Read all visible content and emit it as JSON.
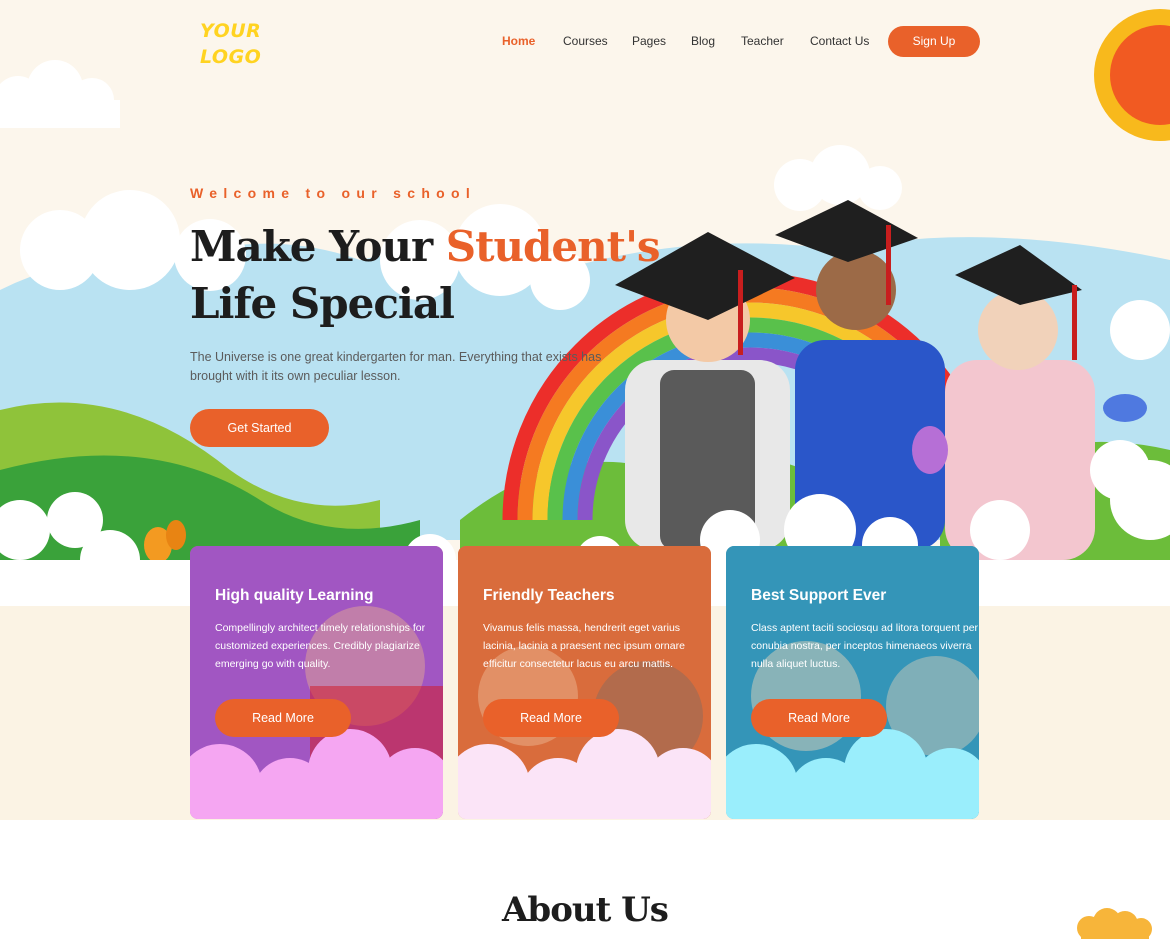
{
  "header": {
    "logo_line1": "YOUR",
    "logo_line2": "LOGO",
    "nav": [
      {
        "label": "Home",
        "active": true
      },
      {
        "label": "Courses",
        "active": false
      },
      {
        "label": "Pages",
        "active": false
      },
      {
        "label": "Blog",
        "active": false
      },
      {
        "label": "Teacher",
        "active": false
      },
      {
        "label": "Contact Us",
        "active": false
      }
    ],
    "signup_label": "Sign Up"
  },
  "hero": {
    "eyebrow": "Welcome to our school",
    "headline_part1": "Make Your ",
    "headline_accent": "Student's",
    "headline_line2": "Life Special",
    "lead": "The Universe is one great kindergarten for man. Everything that exists has brought with it its own peculiar lesson.",
    "cta_label": "Get Started",
    "illustration_icons": [
      "sun-icon",
      "rainbow-icon",
      "graduation-cap-icon",
      "butterfly-icon"
    ]
  },
  "features": [
    {
      "title": "High quality Learning",
      "text": "Compellingly architect timely relationships for customized experiences. Credibly plagiarize emerging go with quality.",
      "button": "Read More",
      "color": "#8d4fe4"
    },
    {
      "title": "Friendly Teachers",
      "text": "Vivamus felis massa, hendrerit eget varius lacinia, lacinia a praesent nec ipsum ornare efficitur consectetur lacus eu arcu mattis.",
      "button": "Read More",
      "color": "#e9612a"
    },
    {
      "title": "Best Support Ever",
      "text": "Class aptent taciti sociosqu ad litora torquent per conubia nostra, per inceptos himenaeos viverra nulla aliquet luctus.",
      "button": "Read More",
      "color": "#0d8fc0"
    }
  ],
  "about": {
    "title": "About Us"
  },
  "colors": {
    "accent": "#e9612a",
    "logo": "#ffd321",
    "hero_bg": "#fcf6ec",
    "sky": "#b9e2f2"
  }
}
